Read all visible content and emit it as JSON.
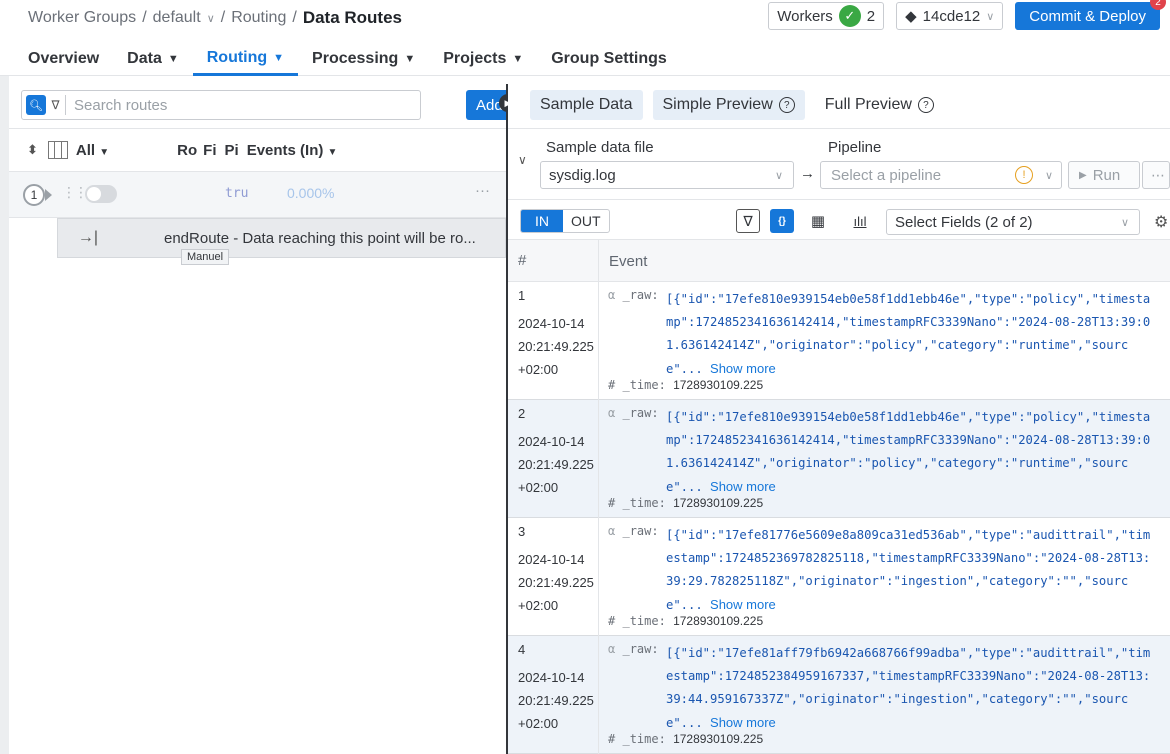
{
  "header": {
    "breadcrumb": {
      "part1": "Worker Groups",
      "sep1": "/",
      "part2": "default",
      "sep2": "/",
      "part3": "Routing",
      "sep3": "/",
      "current": "Data Routes"
    },
    "tabs": [
      {
        "label": "Overview",
        "dropdown": false
      },
      {
        "label": "Data",
        "dropdown": true
      },
      {
        "label": "Routing",
        "dropdown": true,
        "active": true
      },
      {
        "label": "Processing",
        "dropdown": true
      },
      {
        "label": "Projects",
        "dropdown": true
      },
      {
        "label": "Group Settings",
        "dropdown": false
      }
    ],
    "workers_label": "Workers",
    "workers_count": "2",
    "commit_id": "14cde12",
    "commit_button": "Commit & Deploy",
    "commit_badge": "2",
    "accent": "#1677d9"
  },
  "routes": {
    "search_placeholder": "Search routes",
    "add_label": "Add",
    "columns": {
      "all": "All",
      "c1": "Ro",
      "c2": "Fi",
      "c3": "Pi",
      "events": "Events (In)"
    },
    "row": {
      "number": "1",
      "filter": "tru",
      "percent": "0.000%",
      "menu": "···"
    },
    "end_route": "endRoute - Data reaching this point will be ro...",
    "tooltip": "Manuel"
  },
  "preview": {
    "tabs": [
      {
        "label": "Sample Data",
        "help": false
      },
      {
        "label": "Simple Preview",
        "help": true
      },
      {
        "label": "Full Preview",
        "help": true
      }
    ],
    "sample_label": "Sample data file",
    "sample_value": "sysdig.log",
    "pipeline_label": "Pipeline",
    "pipeline_placeholder": "Select a pipeline",
    "run_label": "Run",
    "in_label": "IN",
    "out_label": "OUT",
    "fields_label": "Select Fields (2 of 2)",
    "col_index": "#",
    "col_event": "Event",
    "raw_key": "_raw:",
    "time_key": "_time:",
    "show_more": "Show more",
    "events": [
      {
        "index": "1",
        "date": "2024-10-14",
        "time": "20:21:49.225",
        "tz": "+02:00",
        "lines": [
          "[{\"id\":\"17efe810e939154eb0e58f1dd1ebb46e\",\"type\":\"policy\",\"timesta",
          "mp\":1724852341636142414,\"timestampRFC3339Nano\":\"2024-08-28T13:39:0",
          "1.636142414Z\",\"originator\":\"policy\",\"category\":\"runtime\",\"sourc",
          "e\"... "
        ],
        "time_value": "1728930109.225"
      },
      {
        "index": "2",
        "date": "2024-10-14",
        "time": "20:21:49.225",
        "tz": "+02:00",
        "lines": [
          "[{\"id\":\"17efe810e939154eb0e58f1dd1ebb46e\",\"type\":\"policy\",\"timesta",
          "mp\":1724852341636142414,\"timestampRFC3339Nano\":\"2024-08-28T13:39:0",
          "1.636142414Z\",\"originator\":\"policy\",\"category\":\"runtime\",\"sourc",
          "e\"... "
        ],
        "time_value": "1728930109.225"
      },
      {
        "index": "3",
        "date": "2024-10-14",
        "time": "20:21:49.225",
        "tz": "+02:00",
        "lines": [
          "[{\"id\":\"17efe81776e5609e8a809ca31ed536ab\",\"type\":\"audittrail\",\"tim",
          "estamp\":1724852369782825118,\"timestampRFC3339Nano\":\"2024-08-28T13:",
          "39:29.782825118Z\",\"originator\":\"ingestion\",\"category\":\"\",\"sourc",
          "e\"... "
        ],
        "time_value": "1728930109.225"
      },
      {
        "index": "4",
        "date": "2024-10-14",
        "time": "20:21:49.225",
        "tz": "+02:00",
        "lines": [
          "[{\"id\":\"17efe81aff79fb6942a668766f99adba\",\"type\":\"audittrail\",\"tim",
          "estamp\":1724852384959167337,\"timestampRFC3339Nano\":\"2024-08-28T13:",
          "39:44.959167337Z\",\"originator\":\"ingestion\",\"category\":\"\",\"sourc",
          "e\"... "
        ],
        "time_value": "1728930109.225"
      }
    ]
  }
}
